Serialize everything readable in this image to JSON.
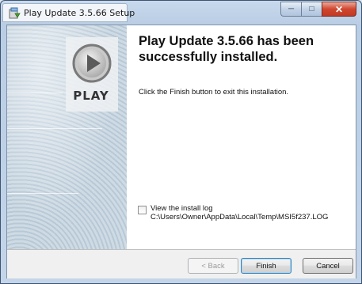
{
  "window": {
    "title": "Play Update 3.5.66 Setup",
    "caption_minimize": "─",
    "caption_maximize": "□",
    "caption_close": "✕"
  },
  "banner": {
    "logo_text": "PLAY"
  },
  "content": {
    "heading": "Play Update 3.5.66 has been successfully installed.",
    "description": "Click the Finish button to exit this installation.",
    "checkbox_label": "View the install log",
    "checkbox_checked": false,
    "log_path": "C:\\Users\\Owner\\AppData\\Local\\Temp\\MSI5f237.LOG"
  },
  "footer": {
    "back_label": "< Back",
    "finish_label": "Finish",
    "cancel_label": "Cancel"
  }
}
